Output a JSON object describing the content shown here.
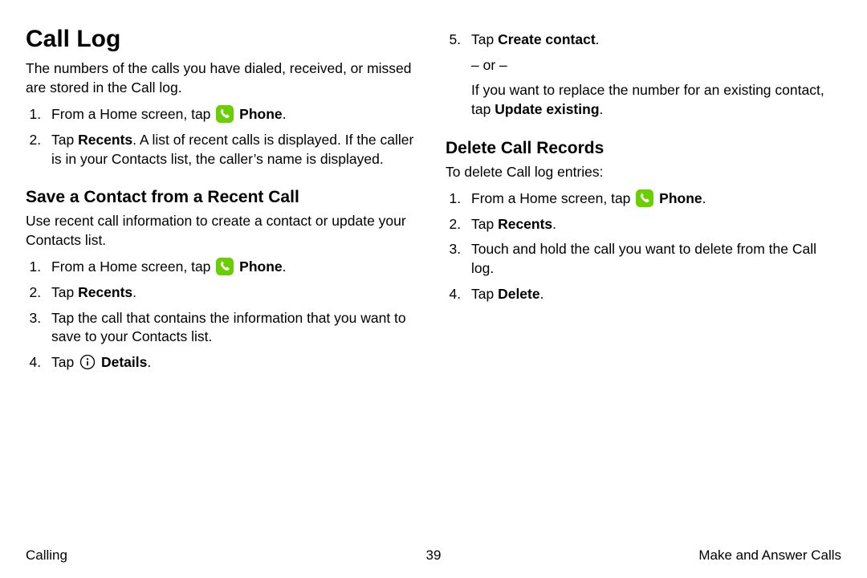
{
  "left": {
    "h1": "Call Log",
    "intro": "The numbers of the calls you have dialed, received, or missed are stored in the Call log.",
    "ol1": {
      "i1_pre": "From a Home screen, tap ",
      "i1_bold": "Phone",
      "i1_post": ".",
      "i2_pre": "Tap ",
      "i2_bold": "Recents",
      "i2_post": ". A list of recent calls is displayed. If the caller is in your Contacts list, the caller’s name is displayed."
    },
    "h2a": "Save a Contact from a Recent Call",
    "p_a": "Use recent call information to create a contact or update your Contacts list.",
    "ol2": {
      "i1_pre": "From a Home screen, tap ",
      "i1_bold": "Phone",
      "i1_post": ".",
      "i2_pre": "Tap ",
      "i2_bold": "Recents",
      "i2_post": ".",
      "i3": "Tap the call that contains the information that you want to save to your Contacts list.",
      "i4_pre": "Tap ",
      "i4_bold": "Details",
      "i4_post": "."
    }
  },
  "right": {
    "ol_cont": {
      "i5_pre": "Tap ",
      "i5_bold": "Create contact",
      "i5_post": ".",
      "or": "– or –",
      "alt_pre": "If you want to replace the number for an existing contact, tap ",
      "alt_bold": "Update existing",
      "alt_post": "."
    },
    "h2b": "Delete Call Records",
    "p_b": "To delete Call log entries:",
    "ol3": {
      "i1_pre": "From a Home screen, tap ",
      "i1_bold": "Phone",
      "i1_post": ".",
      "i2_pre": "Tap ",
      "i2_bold": "Recents",
      "i2_post": ".",
      "i3": "Touch and hold the call you want to delete from the Call log.",
      "i4_pre": "Tap ",
      "i4_bold": "Delete",
      "i4_post": "."
    }
  },
  "footer": {
    "left": "Calling",
    "center": "39",
    "right": "Make and Answer Calls"
  }
}
